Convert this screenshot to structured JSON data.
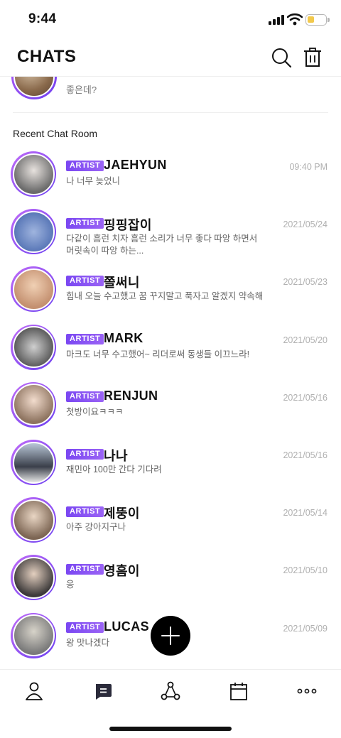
{
  "status_bar": {
    "time": "9:44",
    "battery_level": 0.35,
    "battery_color": "#f2c94c"
  },
  "header": {
    "title": "CHATS",
    "search_icon": "search-icon",
    "delete_icon": "trash-icon"
  },
  "partial_chat": {
    "message": "좋은데?"
  },
  "section_title": "Recent Chat Room",
  "badge_label": "ARTIST",
  "chats": [
    {
      "name": "JAEHYUN",
      "time": "09:40 PM",
      "message": "나 너무 늦었니"
    },
    {
      "name": "핑핑잡이",
      "time": "2021/05/24",
      "message": "다같이 흠런 치자 흠런 소리가 너무 좋다 따앙 하면서 머릿속이 따앙 하는..."
    },
    {
      "name": "쫄써니",
      "time": "2021/05/23",
      "message": "힘내 오늘 수고했고 꿈 꾸지말고 푹자고 알겠지 약속해"
    },
    {
      "name": "MARK",
      "time": "2021/05/20",
      "message": "마크도 너무 수고했어~ 리더로써 동생들 이끄느라!"
    },
    {
      "name": "RENJUN",
      "time": "2021/05/16",
      "message": "첫방이요ㅋㅋㅋ"
    },
    {
      "name": "나나",
      "time": "2021/05/16",
      "message": "재민아 100만 간다 기다려"
    },
    {
      "name": "제뚱이",
      "time": "2021/05/14",
      "message": "아주 강아지구나"
    },
    {
      "name": "영흠이",
      "time": "2021/05/10",
      "message": "응"
    },
    {
      "name": "LUCAS",
      "time": "2021/05/09",
      "message": "왕 맛나겠다"
    }
  ],
  "tabs": [
    "profile-icon",
    "chat-icon",
    "share-icon",
    "calendar-icon",
    "more-icon"
  ],
  "colors": {
    "accent": "#7a47f2",
    "avatar_ring": "#b15cf5"
  }
}
